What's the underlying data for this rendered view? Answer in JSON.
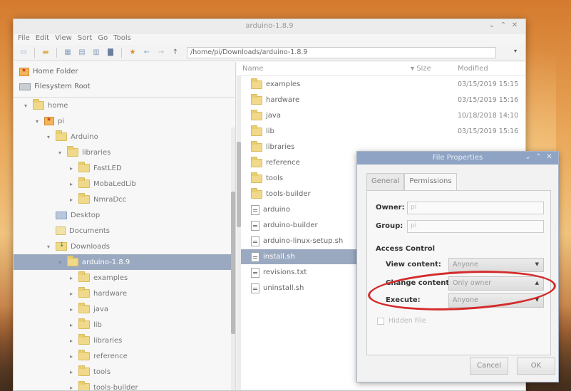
{
  "window": {
    "title": "arduino-1.8.9",
    "controls": [
      "⌄",
      "⌃",
      "✕"
    ]
  },
  "menu": [
    "File",
    "Edit",
    "View",
    "Sort",
    "Go",
    "Tools"
  ],
  "toolbar": {
    "path": "/home/pi/Downloads/arduino-1.8.9"
  },
  "sidebar": {
    "places": [
      {
        "label": "Home Folder",
        "icon": "home-folder-icon"
      },
      {
        "label": "Filesystem Root",
        "icon": "drive-icon"
      }
    ],
    "tree": [
      {
        "label": "home",
        "indent": 0,
        "expander": "▾",
        "icon": "folder"
      },
      {
        "label": "pi",
        "indent": 1,
        "expander": "▾",
        "icon": "home"
      },
      {
        "label": "Arduino",
        "indent": 2,
        "expander": "▾",
        "icon": "folder"
      },
      {
        "label": "libraries",
        "indent": 3,
        "expander": "▾",
        "icon": "folder"
      },
      {
        "label": "FastLED",
        "indent": 4,
        "expander": "▸",
        "icon": "folder"
      },
      {
        "label": "MobaLedLib",
        "indent": 4,
        "expander": "▸",
        "icon": "folder"
      },
      {
        "label": "NmraDcc",
        "indent": 4,
        "expander": "▸",
        "icon": "folder"
      },
      {
        "label": "Desktop",
        "indent": 2,
        "expander": "",
        "icon": "desktop"
      },
      {
        "label": "Documents",
        "indent": 2,
        "expander": "",
        "icon": "documents"
      },
      {
        "label": "Downloads",
        "indent": 2,
        "expander": "▾",
        "icon": "downloads"
      },
      {
        "label": "arduino-1.8.9",
        "indent": 3,
        "expander": "▾",
        "icon": "folder",
        "selected": true
      },
      {
        "label": "examples",
        "indent": 4,
        "expander": "▸",
        "icon": "folder"
      },
      {
        "label": "hardware",
        "indent": 4,
        "expander": "▸",
        "icon": "folder"
      },
      {
        "label": "java",
        "indent": 4,
        "expander": "▸",
        "icon": "folder"
      },
      {
        "label": "lib",
        "indent": 4,
        "expander": "▸",
        "icon": "folder"
      },
      {
        "label": "libraries",
        "indent": 4,
        "expander": "▸",
        "icon": "folder"
      },
      {
        "label": "reference",
        "indent": 4,
        "expander": "▸",
        "icon": "folder"
      },
      {
        "label": "tools",
        "indent": 4,
        "expander": "▸",
        "icon": "folder"
      },
      {
        "label": "tools-builder",
        "indent": 4,
        "expander": "▸",
        "icon": "folder"
      }
    ]
  },
  "filelist": {
    "columns": {
      "name": "Name",
      "size": "▾  Size",
      "modified": "Modified"
    },
    "files": [
      {
        "name": "examples",
        "type": "folder",
        "modified": "03/15/2019 15:15"
      },
      {
        "name": "hardware",
        "type": "folder",
        "modified": "03/15/2019 15:16"
      },
      {
        "name": "java",
        "type": "folder",
        "modified": "10/18/2018 14:10"
      },
      {
        "name": "lib",
        "type": "folder",
        "modified": "03/15/2019 15:16"
      },
      {
        "name": "libraries",
        "type": "folder",
        "modified": ""
      },
      {
        "name": "reference",
        "type": "folder",
        "modified": ""
      },
      {
        "name": "tools",
        "type": "folder",
        "modified": ""
      },
      {
        "name": "tools-builder",
        "type": "folder",
        "modified": ""
      },
      {
        "name": "arduino",
        "type": "file",
        "modified": ""
      },
      {
        "name": "arduino-builder",
        "type": "file",
        "modified": ""
      },
      {
        "name": "arduino-linux-setup.sh",
        "type": "file",
        "modified": ""
      },
      {
        "name": "install.sh",
        "type": "file",
        "modified": "",
        "selected": true
      },
      {
        "name": "revisions.txt",
        "type": "file",
        "modified": ""
      },
      {
        "name": "uninstall.sh",
        "type": "file",
        "modified": ""
      }
    ]
  },
  "dialog": {
    "title": "File Properties",
    "controls": [
      "⌄",
      "⌃",
      "✕"
    ],
    "tabs": [
      "General",
      "Permissions"
    ],
    "owner_label": "Owner:",
    "owner_value": "pi",
    "group_label": "Group:",
    "group_value": "pi",
    "access_control": "Access Control",
    "view_content_label": "View content:",
    "view_content_value": "Anyone",
    "change_content_label": "Change content:",
    "change_content_value": "Only owner",
    "execute_label": "Execute:",
    "execute_value": "Anyone",
    "hidden_file_label": "Hidden File",
    "cancel": "Cancel",
    "ok": "OK"
  },
  "colors": {
    "selection": "#9aa9c0",
    "highlight_ring": "#d42a2a",
    "dialog_titlebar": "#8fa4c4"
  }
}
